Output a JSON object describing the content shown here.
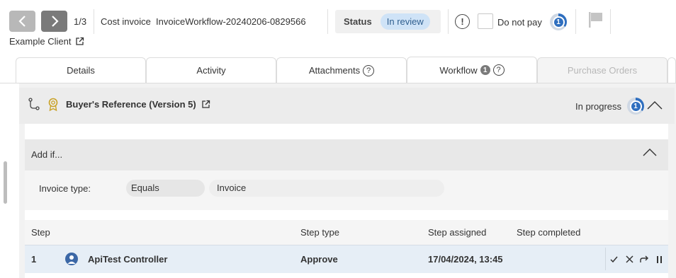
{
  "header": {
    "counter": "1/3",
    "doc_type": "Cost invoice",
    "doc_id": "InvoiceWorkflow-20240206-0829566",
    "client": "Example Client",
    "status_label": "Status",
    "status_value": "In review",
    "do_not_pay_label": "Do not pay",
    "progress_count": "1"
  },
  "tabs": [
    {
      "label": "Details"
    },
    {
      "label": "Activity"
    },
    {
      "label": "Attachments"
    },
    {
      "label": "Workflow",
      "badge": "1"
    },
    {
      "label": "Purchase Orders"
    }
  ],
  "workflow": {
    "title": "Buyer's Reference (Version 5)",
    "status": "In progress",
    "progress_count": "1"
  },
  "condition": {
    "section_label": "Add if...",
    "field_label": "Invoice type:",
    "operator": "Equals",
    "value": "Invoice"
  },
  "steps": {
    "columns": [
      "Step",
      "Step type",
      "Step assigned",
      "Step completed"
    ],
    "rows": [
      {
        "step": "1",
        "name": "ApiTest Controller",
        "type": "Approve",
        "assigned": "17/04/2024, 13:45",
        "completed": ""
      }
    ]
  },
  "colors": {
    "accent": "#2f6fbf",
    "status_pill": "#cfe3f7",
    "row_highlight": "#e6eef6"
  },
  "icons": [
    "chevron-left-icon",
    "chevron-right-icon",
    "external-link-icon",
    "alert-icon",
    "progress-ring-icon",
    "flag-icon",
    "help-icon",
    "branch-icon",
    "award-icon",
    "chevron-up-icon",
    "user-icon",
    "check-icon",
    "close-icon",
    "forward-icon",
    "pause-icon"
  ]
}
